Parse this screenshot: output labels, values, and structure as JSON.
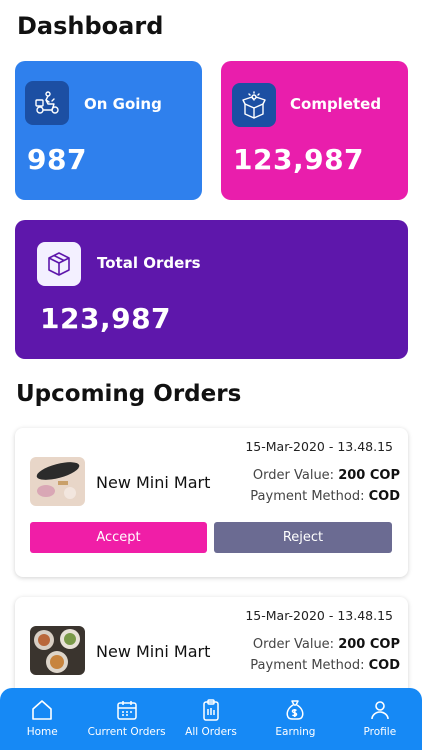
{
  "header": {
    "title": "Dashboard"
  },
  "stats": {
    "ongoing": {
      "label": "On Going",
      "value": "987",
      "icon": "scooter-delivery-icon"
    },
    "completed": {
      "label": "Completed",
      "value": "123,987",
      "icon": "open-box-icon"
    },
    "total": {
      "label": "Total Orders",
      "value": "123,987",
      "icon": "box-icon"
    }
  },
  "upcoming": {
    "title": "Upcoming Orders",
    "orders": [
      {
        "date": "15-Mar-2020 - 13.48.15",
        "store": "New Mini Mart",
        "order_value_label": "Order Value:",
        "order_value": "200 COP",
        "payment_label": "Payment Method:",
        "payment_method": "COD",
        "accept_label": "Accept",
        "reject_label": "Reject"
      },
      {
        "date": "15-Mar-2020 - 13.48.15",
        "store": "New Mini Mart",
        "order_value_label": "Order Value:",
        "order_value": "200 COP",
        "payment_label": "Payment Method:",
        "payment_method": "COD"
      }
    ]
  },
  "nav": {
    "items": [
      {
        "label": "Home",
        "icon": "home-icon"
      },
      {
        "label": "Current Orders",
        "icon": "calendar-icon"
      },
      {
        "label": "All Orders",
        "icon": "clipboard-icon"
      },
      {
        "label": "Earning",
        "icon": "money-bag-icon"
      },
      {
        "label": "Profile",
        "icon": "user-icon"
      }
    ]
  },
  "colors": {
    "ongoing": "#2f80ed",
    "completed": "#e91eac",
    "total": "#5e17ab",
    "accept": "#f01ea7",
    "reject": "#6b6b92",
    "nav": "#1689f5"
  }
}
